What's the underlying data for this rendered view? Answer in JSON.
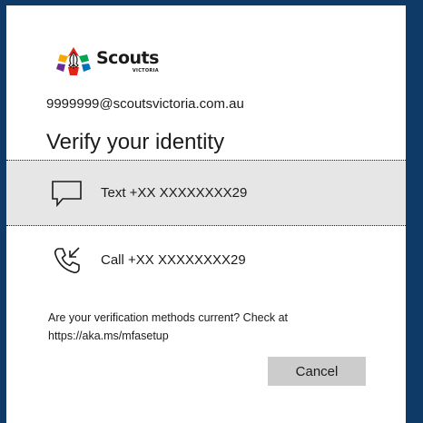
{
  "logo": {
    "word": "Scouts",
    "sub": "VICTORIA"
  },
  "account": "9999999@scoutsvictoria.com.au",
  "title": "Verify your identity",
  "options": [
    {
      "icon": "message-icon",
      "label": "Text +XX XXXXXXXX29",
      "selected": true
    },
    {
      "icon": "phone-call-icon",
      "label": "Call +XX XXXXXXXX29",
      "selected": false
    }
  ],
  "note": {
    "line1": "Are your verification methods current? Check at",
    "line2": "https://aka.ms/mfasetup"
  },
  "cancel_label": "Cancel",
  "colors": {
    "background": "#0d3a66",
    "selected_row": "#e6e6e6",
    "button": "#cccccc"
  }
}
